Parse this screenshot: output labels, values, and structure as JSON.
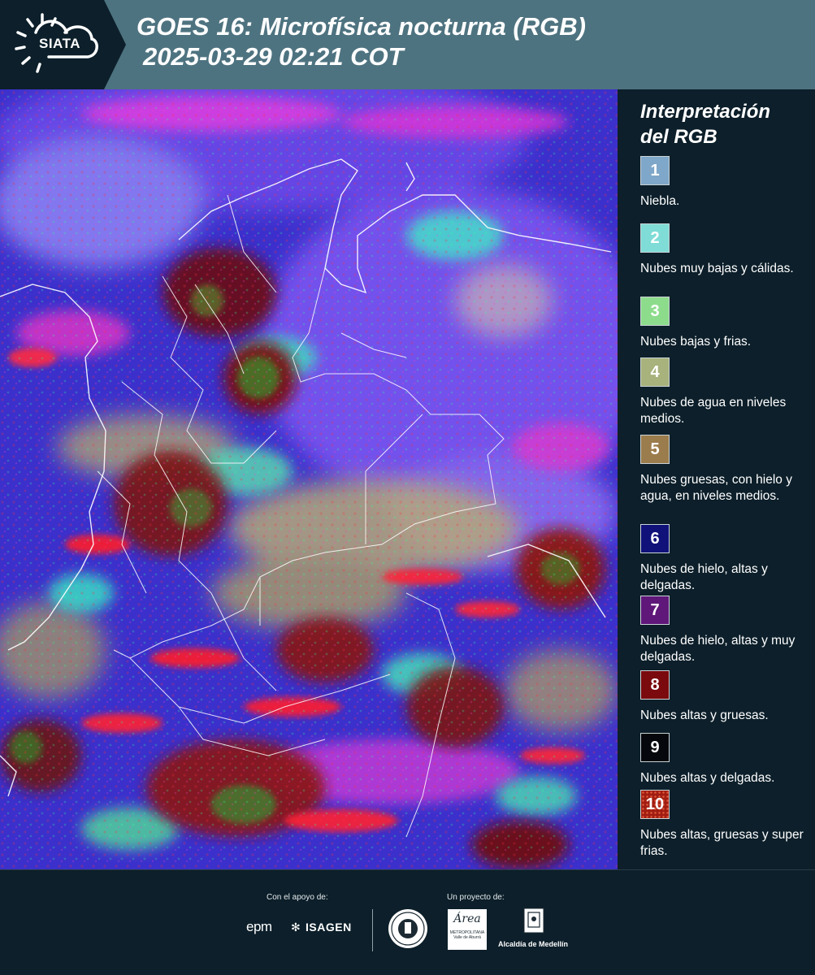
{
  "header": {
    "logo_text": "SIATA",
    "title_line1": "GOES 16: Microfísica nocturna (RGB)",
    "title_line2": "2025-03-29 02:21 COT",
    "background": "#4e7380"
  },
  "map": {
    "description_icon": "satellite-rgb-map"
  },
  "legend": {
    "title_line1": "Interpretación",
    "title_line2": "del RGB",
    "items": [
      {
        "number": "1",
        "label": "Niebla.",
        "color": "#7ea7c9"
      },
      {
        "number": "2",
        "label": "Nubes muy bajas y cálidas.",
        "color": "#7fdcd6"
      },
      {
        "number": "3",
        "label": "Nubes bajas y frias.",
        "color": "#8ddc8c"
      },
      {
        "number": "4",
        "label": "Nubes de agua en niveles medios.",
        "color": "#a7b27c"
      },
      {
        "number": "5",
        "label": "Nubes gruesas, con hielo y agua, en niveles medios.",
        "color": "#9b7c4c"
      },
      {
        "number": "6",
        "label": "Nubes de hielo, altas y delgadas.",
        "color": "#10127a"
      },
      {
        "number": "7",
        "label": "Nubes de hielo, altas y muy delgadas.",
        "color": "#5f1779"
      },
      {
        "number": "8",
        "label": "Nubes altas y gruesas.",
        "color": "#7a0a0d"
      },
      {
        "number": "9",
        "label": "Nubes altas y delgadas.",
        "color": "#05070c"
      },
      {
        "number": "10",
        "label": "Nubes altas, gruesas y super frias.",
        "color": "#a11d12"
      }
    ]
  },
  "footer": {
    "support_label": "Con el apoyo de:",
    "project_label": "Un proyecto de:",
    "epm": "epm",
    "isagen": "ISAGEN",
    "area_text": "Área",
    "area_sub": "METROPOLITANA Valle de Aburrá",
    "alcaldia": "Alcaldía de Medellín"
  }
}
